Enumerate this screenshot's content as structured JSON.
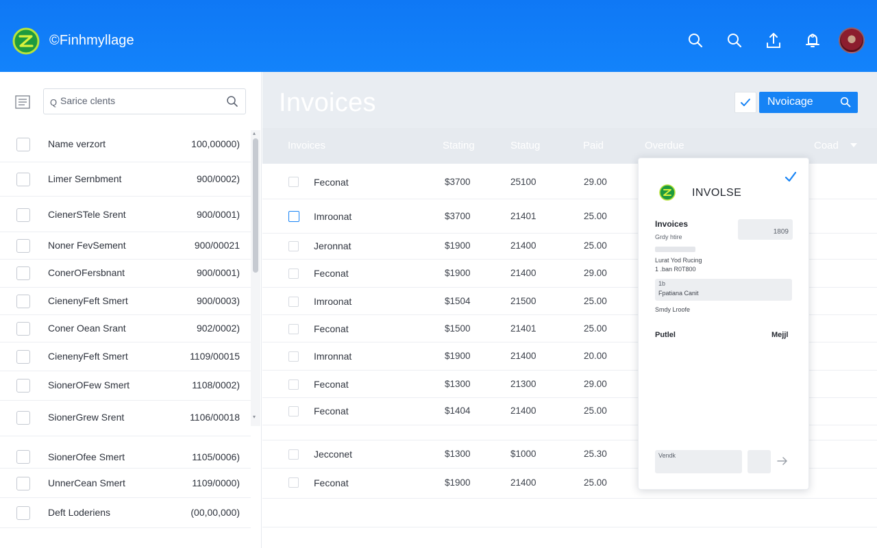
{
  "app": {
    "brand": "©Finhmyllage",
    "accent": "#1383fb"
  },
  "header_icons": [
    "search-icon",
    "search-icon",
    "upload-icon",
    "bell-icon",
    "avatar"
  ],
  "sidebar": {
    "search_lead": "Q",
    "search_placeholder": "Sarice clents",
    "clients": [
      {
        "name": "Name verzort",
        "amount": "100,00000)"
      },
      {
        "name": "Limer Sernbment",
        "amount": "900/0002)"
      },
      {
        "name": "CienerSTele Srent",
        "amount": "900/0001)"
      },
      {
        "name": "Noner FevSement",
        "amount": "900/00021"
      },
      {
        "name": "ConerOFersbnant",
        "amount": "900/0001)"
      },
      {
        "name": "CienenyFeft Smert",
        "amount": "900/0003)"
      },
      {
        "name": "Coner Oean Srant",
        "amount": "902/0002)"
      },
      {
        "name": "CienenyFeft Smert",
        "amount": "1109/00015"
      },
      {
        "name": "SionerOFew Smert",
        "amount": "1108/0002)"
      },
      {
        "name": "SionerGrew Srent",
        "amount": "1106/00018"
      },
      {
        "name": "SionerOfee Smert",
        "amount": "1105/0006)"
      },
      {
        "name": "UnnerCean Smert",
        "amount": "1109/0000)"
      },
      {
        "name": "Deft Loderiens",
        "amount": "(00,00,000)"
      }
    ]
  },
  "main": {
    "title": "Invoices",
    "primary_button": "Nvoicage",
    "columns": {
      "invoices": "Invoices",
      "stating": "Stating",
      "status": "Statug",
      "paid": "Paid",
      "overdue": "Overdue",
      "coad": "Coad"
    },
    "rows": [
      {
        "name": "Feconat",
        "stating": "$3700",
        "status": "25100",
        "paid": "29.00",
        "selected": false
      },
      {
        "name": "Imroonat",
        "stating": "$3700",
        "status": "21401",
        "paid": "25.00",
        "selected": true
      },
      {
        "name": "Jeronnat",
        "stating": "$1900",
        "status": "21400",
        "paid": "25.00",
        "selected": false
      },
      {
        "name": "Feconat",
        "stating": "$1900",
        "status": "21400",
        "paid": "29.00",
        "selected": false
      },
      {
        "name": "Imroonat",
        "stating": "$1504",
        "status": "21500",
        "paid": "25.00",
        "selected": false
      },
      {
        "name": "Feconat",
        "stating": "$1500",
        "status": "21401",
        "paid": "25.00",
        "selected": false
      },
      {
        "name": "Imronnat",
        "stating": "$1900",
        "status": "21400",
        "paid": "20.00",
        "selected": false
      },
      {
        "name": "Feconat",
        "stating": "$1300",
        "status": "21300",
        "paid": "29.00",
        "selected": false
      },
      {
        "name": "Feconat",
        "stating": "$1404",
        "status": "21400",
        "paid": "25.00",
        "selected": false
      },
      {
        "name": "Jecconet",
        "stating": "$1300",
        "status": "$1000",
        "paid": "25.30",
        "selected": false
      },
      {
        "name": "Feconat",
        "stating": "$1900",
        "status": "21400",
        "paid": "25.00",
        "selected": false
      }
    ]
  },
  "card": {
    "title": "INVOLSE",
    "section": "Invoices",
    "sub": "Grdy htire",
    "field_value": "1809",
    "line1": "Lurat Yod Rucing",
    "line2": "1 .ban R0T800",
    "field2_label": "1b",
    "field2_value": "Fpatiana Canit",
    "note": "Smdy Lroofe",
    "footer_left": "Putlel",
    "footer_right": "Mejjl",
    "action_label": "Vendk"
  }
}
